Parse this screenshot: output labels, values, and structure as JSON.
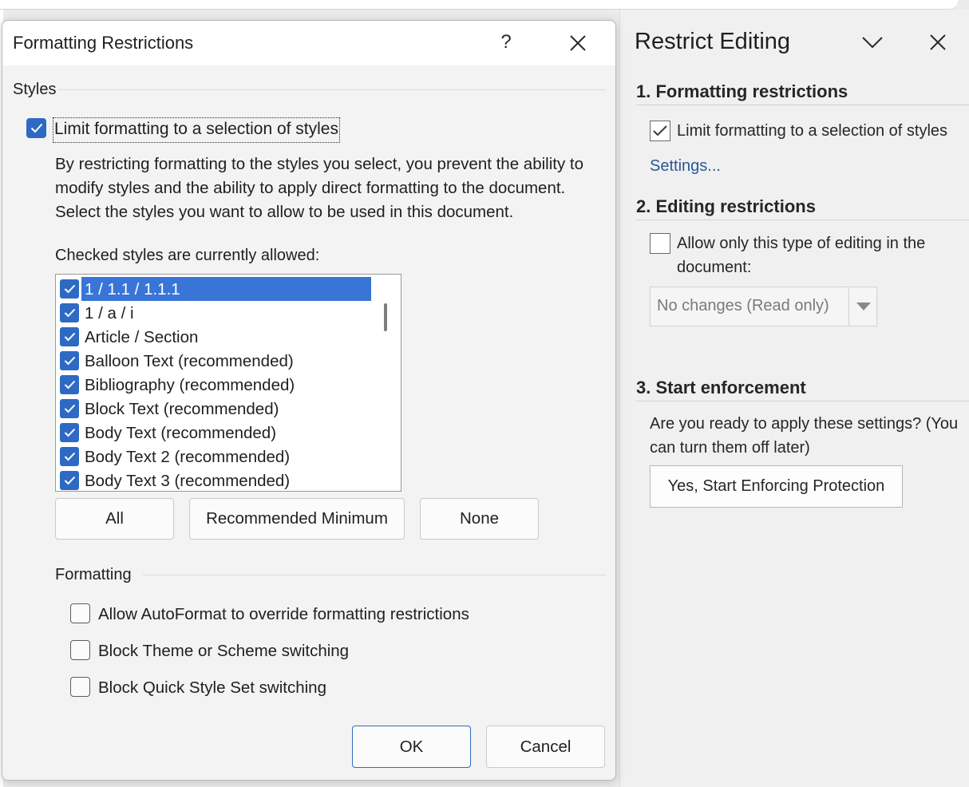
{
  "dialog": {
    "title": "Formatting Restrictions",
    "help_label": "?",
    "styles_group": "Styles",
    "limit_checkbox_label": "Limit formatting to a selection of styles",
    "description": [
      "By restricting formatting to the styles you select, you prevent the ability to",
      "modify styles and the ability to apply direct formatting to the document.",
      "Select the styles you want to allow to be used in this document."
    ],
    "list_caption": "Checked styles are currently allowed:",
    "styles_list": [
      "1 / 1.1 / 1.1.1",
      "1 / a / i",
      "Article / Section",
      "Balloon Text (recommended)",
      "Bibliography (recommended)",
      "Block Text (recommended)",
      "Body Text (recommended)",
      "Body Text 2 (recommended)",
      "Body Text 3 (recommended)"
    ],
    "buttons": {
      "all": "All",
      "recommended_minimum": "Recommended Minimum",
      "none": "None",
      "ok": "OK",
      "cancel": "Cancel"
    },
    "formatting_group": "Formatting",
    "formatting_options": [
      "Allow AutoFormat to override formatting restrictions",
      "Block Theme or Scheme switching",
      "Block Quick Style Set switching"
    ]
  },
  "pane": {
    "title": "Restrict Editing",
    "section1": "1. Formatting restrictions",
    "limit_label": "Limit formatting to a selection of styles",
    "settings_link": "Settings...",
    "section2": "2. Editing restrictions",
    "allow_label_line1": "Allow only this type of editing in the",
    "allow_label_line2": "document:",
    "editing_type": "No changes (Read only)",
    "section3": "3. Start enforcement",
    "enforce_text_line1": "Are you ready to apply these settings? (You",
    "enforce_text_line2": "can turn them off later)",
    "enforce_button": "Yes, Start Enforcing Protection"
  },
  "colors": {
    "accent": "#2e6ac4",
    "selection": "#3875d7",
    "link": "#2b5797"
  }
}
